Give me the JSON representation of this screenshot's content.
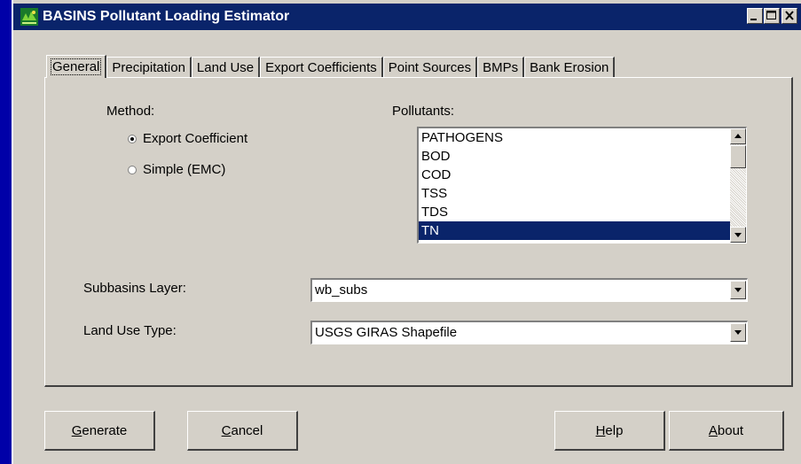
{
  "window": {
    "title": "BASINS Pollutant Loading Estimator",
    "controls": {
      "minimize": "_",
      "maximize": "□",
      "close": "×"
    }
  },
  "tabs": [
    {
      "label": "General",
      "active": true
    },
    {
      "label": "Precipitation"
    },
    {
      "label": "Land Use"
    },
    {
      "label": "Export Coefficients"
    },
    {
      "label": "Point Sources"
    },
    {
      "label": "BMPs"
    },
    {
      "label": "Bank Erosion"
    }
  ],
  "general": {
    "method_label": "Method:",
    "method_options": [
      {
        "label": "Export Coefficient",
        "checked": true
      },
      {
        "label": "Simple (EMC)",
        "checked": false
      }
    ],
    "pollutants_label": "Pollutants:",
    "pollutants": [
      "PATHOGENS",
      "BOD",
      "COD",
      "TSS",
      "TDS",
      "TN"
    ],
    "pollutants_selected": "TN",
    "subbasins_label": "Subbasins Layer:",
    "subbasins_value": "wb_subs",
    "landuse_label": "Land Use Type:",
    "landuse_value": "USGS GIRAS Shapefile"
  },
  "buttons": {
    "generate": {
      "mnemonic": "G",
      "rest": "enerate"
    },
    "cancel": {
      "mnemonic": "C",
      "rest": "ancel"
    },
    "help": {
      "mnemonic": "H",
      "rest": "elp"
    },
    "about": {
      "mnemonic": "A",
      "rest": "bout"
    }
  },
  "colors": {
    "desktop": "#0000a8",
    "titlebar": "#0a246a",
    "face": "#d4d0c8",
    "selection": "#0a246a"
  }
}
